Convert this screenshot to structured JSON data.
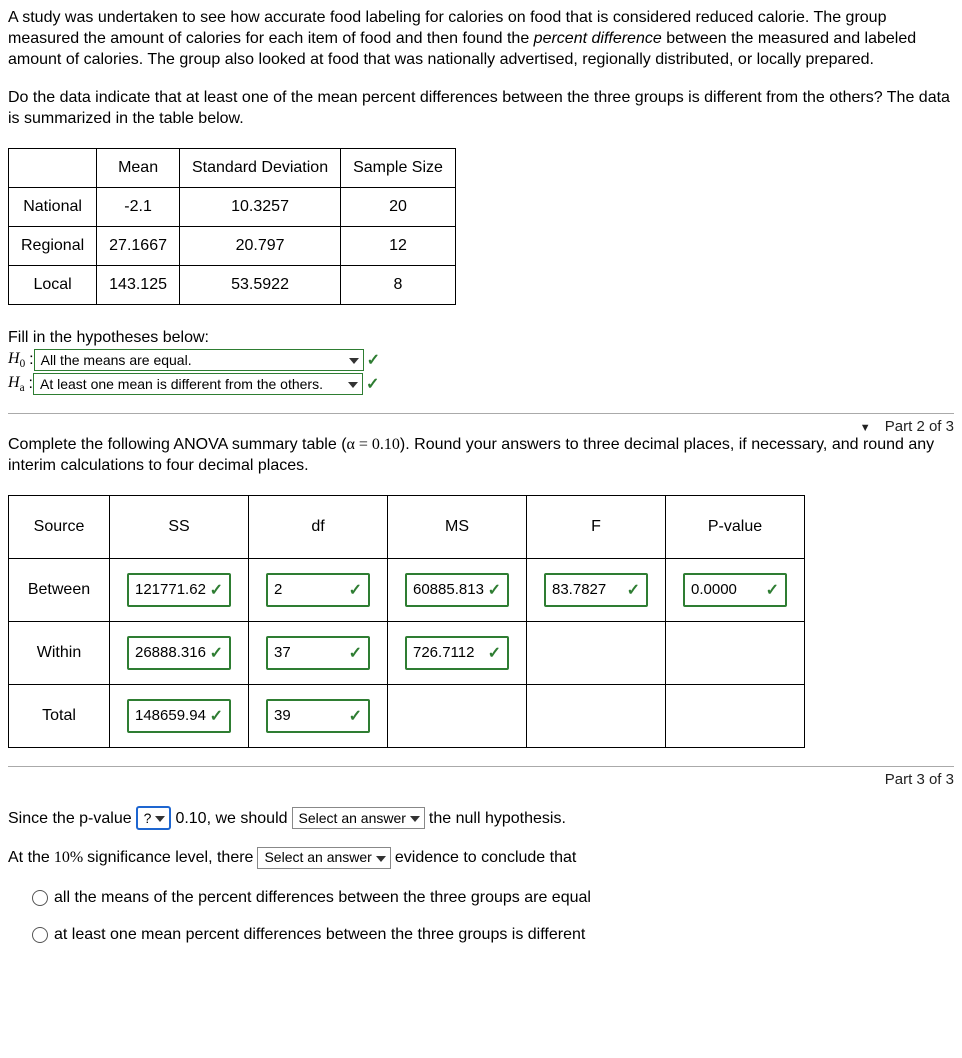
{
  "intro": {
    "p1a": "A study was undertaken to see how accurate food labeling for calories on food that is considered reduced calorie. The group measured the amount of calories for each item of food and then found the ",
    "p1_em": "percent difference",
    "p1b": " between the measured and labeled amount of calories. The group also looked at food that was nationally advertised, regionally distributed, or locally prepared.",
    "p2": "Do the data indicate that at least one of the mean percent differences between the three groups is different from the others? The data is summarized in the table below."
  },
  "summary_table": {
    "headers": {
      "mean": "Mean",
      "sd": "Standard Deviation",
      "n": "Sample Size"
    },
    "rows": [
      {
        "label": "National",
        "mean": "-2.1",
        "sd": "10.3257",
        "n": "20"
      },
      {
        "label": "Regional",
        "mean": "27.1667",
        "sd": "20.797",
        "n": "12"
      },
      {
        "label": "Local",
        "mean": "143.125",
        "sd": "53.5922",
        "n": "8"
      }
    ]
  },
  "hypotheses": {
    "prompt": "Fill in the hypotheses below:",
    "h0_label": "H",
    "h0_sub": "0",
    "h0_colon": " : ",
    "h0_value": "All the means are equal.",
    "ha_label": "H",
    "ha_sub": "a",
    "ha_colon": " : ",
    "ha_value": "At least one mean is different from the others."
  },
  "part2_label": "Part 2 of 3",
  "part2_text_a": "Complete the following ANOVA summary table (",
  "part2_alpha": "α = 0.10",
  "part2_text_b": "). Round your answers to three decimal places, if necessary, and round any interim calculations to four decimal places.",
  "anova": {
    "headers": {
      "source": "Source",
      "ss": "SS",
      "df": "df",
      "ms": "MS",
      "f": "F",
      "p": "P-value"
    },
    "rows": {
      "between": {
        "label": "Between",
        "ss": "121771.62",
        "df": "2",
        "ms": "60885.813",
        "f": "83.7827",
        "p": "0.0000"
      },
      "within": {
        "label": "Within",
        "ss": "26888.316",
        "df": "37",
        "ms": "726.7112"
      },
      "total": {
        "label": "Total",
        "ss": "148659.94",
        "df": "39"
      }
    }
  },
  "part3_label": "Part 3 of 3",
  "conclusion": {
    "line1_a": "Since the p-value ",
    "drop1": "?",
    "line1_b": " 0.10, we should ",
    "drop2": "Select an answer",
    "line1_c": " the null hypothesis.",
    "line2_a": "At the ",
    "pct": "10%",
    "line2_b": " significance level, there ",
    "drop3": "Select an answer",
    "line2_c": " evidence to conclude that",
    "opt1": "all the means of the percent differences between the three groups are equal",
    "opt2": "at least one mean percent differences between the three groups is different"
  }
}
